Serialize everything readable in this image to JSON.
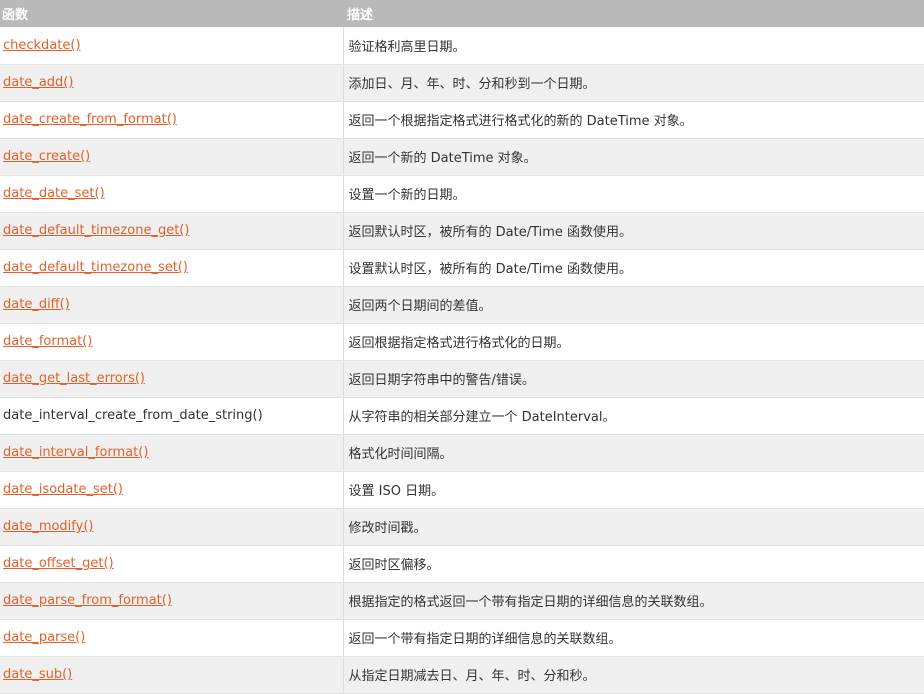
{
  "table": {
    "headers": {
      "function": "函数",
      "description": "描述"
    },
    "rows": [
      {
        "function": "checkdate()",
        "is_link": true,
        "description": "验证格利高里日期。"
      },
      {
        "function": "date_add()",
        "is_link": true,
        "description": "添加日、月、年、时、分和秒到一个日期。"
      },
      {
        "function": "date_create_from_format()",
        "is_link": true,
        "description": "返回一个根据指定格式进行格式化的新的 DateTime 对象。"
      },
      {
        "function": "date_create()",
        "is_link": true,
        "description": "返回一个新的 DateTime 对象。"
      },
      {
        "function": "date_date_set()",
        "is_link": true,
        "description": "设置一个新的日期。"
      },
      {
        "function": "date_default_timezone_get()",
        "is_link": true,
        "description": "返回默认时区，被所有的 Date/Time 函数使用。"
      },
      {
        "function": "date_default_timezone_set()",
        "is_link": true,
        "description": "设置默认时区，被所有的 Date/Time 函数使用。"
      },
      {
        "function": "date_diff()",
        "is_link": true,
        "description": "返回两个日期间的差值。"
      },
      {
        "function": "date_format()",
        "is_link": true,
        "description": "返回根据指定格式进行格式化的日期。"
      },
      {
        "function": "date_get_last_errors()",
        "is_link": true,
        "description": "返回日期字符串中的警告/错误。"
      },
      {
        "function": "date_interval_create_from_date_string()",
        "is_link": false,
        "description": "从字符串的相关部分建立一个 DateInterval。"
      },
      {
        "function": "date_interval_format()",
        "is_link": true,
        "description": "格式化时间间隔。"
      },
      {
        "function": "date_isodate_set()",
        "is_link": true,
        "description": "设置 ISO 日期。"
      },
      {
        "function": "date_modify()",
        "is_link": true,
        "description": "修改时间戳。"
      },
      {
        "function": "date_offset_get()",
        "is_link": true,
        "description": "返回时区偏移。"
      },
      {
        "function": "date_parse_from_format()",
        "is_link": true,
        "description": "根据指定的格式返回一个带有指定日期的详细信息的关联数组。"
      },
      {
        "function": "date_parse()",
        "is_link": true,
        "description": "返回一个带有指定日期的详细信息的关联数组。"
      },
      {
        "function": "date_sub()",
        "is_link": true,
        "description": "从指定日期减去日、月、年、时、分和秒。"
      }
    ]
  },
  "colors": {
    "header_bg": "#b9b9b9",
    "link": "#e2612b",
    "row_alt": "#f0f0f0"
  }
}
